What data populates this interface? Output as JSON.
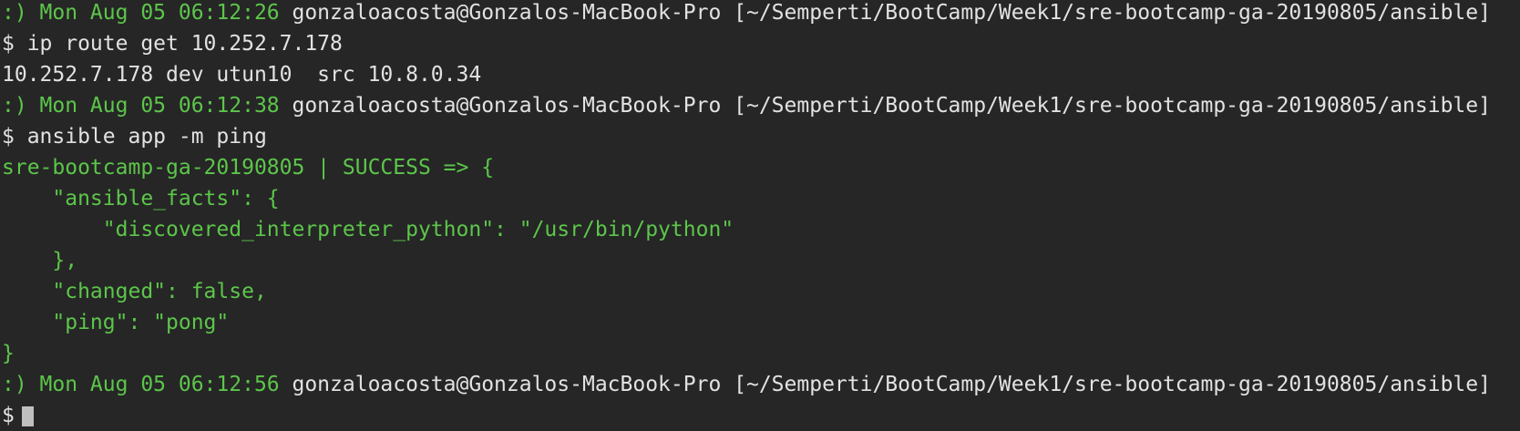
{
  "theme": {
    "background": "#262626",
    "text": "#e2e2e2",
    "green": "#5cc64a",
    "cursor": "#bfbfbf"
  },
  "terminal": {
    "prompts": [
      {
        "status_time": ":) Mon Aug 05 06:12:26",
        "user_host_path": " gonzaloacosta@Gonzalos-MacBook-Pro [~/Semperti/BootCamp/Week1/sre-bootcamp-ga-20190805/ansible]"
      },
      {
        "status_time": ":) Mon Aug 05 06:12:38",
        "user_host_path": " gonzaloacosta@Gonzalos-MacBook-Pro [~/Semperti/BootCamp/Week1/sre-bootcamp-ga-20190805/ansible]"
      },
      {
        "status_time": ":) Mon Aug 05 06:12:56",
        "user_host_path": " gonzaloacosta@Gonzalos-MacBook-Pro [~/Semperti/BootCamp/Week1/sre-bootcamp-ga-20190805/ansible]"
      }
    ],
    "commands": [
      "$ ip route get 10.252.7.178",
      "$ ansible app -m ping",
      "$"
    ],
    "route_output": "10.252.7.178 dev utun10  src 10.8.0.34",
    "ansible_output": [
      "sre-bootcamp-ga-20190805 | SUCCESS => {",
      "    \"ansible_facts\": {",
      "        \"discovered_interpreter_python\": \"/usr/bin/python\"",
      "    },",
      "    \"changed\": false,",
      "    \"ping\": \"pong\"",
      "}"
    ]
  }
}
